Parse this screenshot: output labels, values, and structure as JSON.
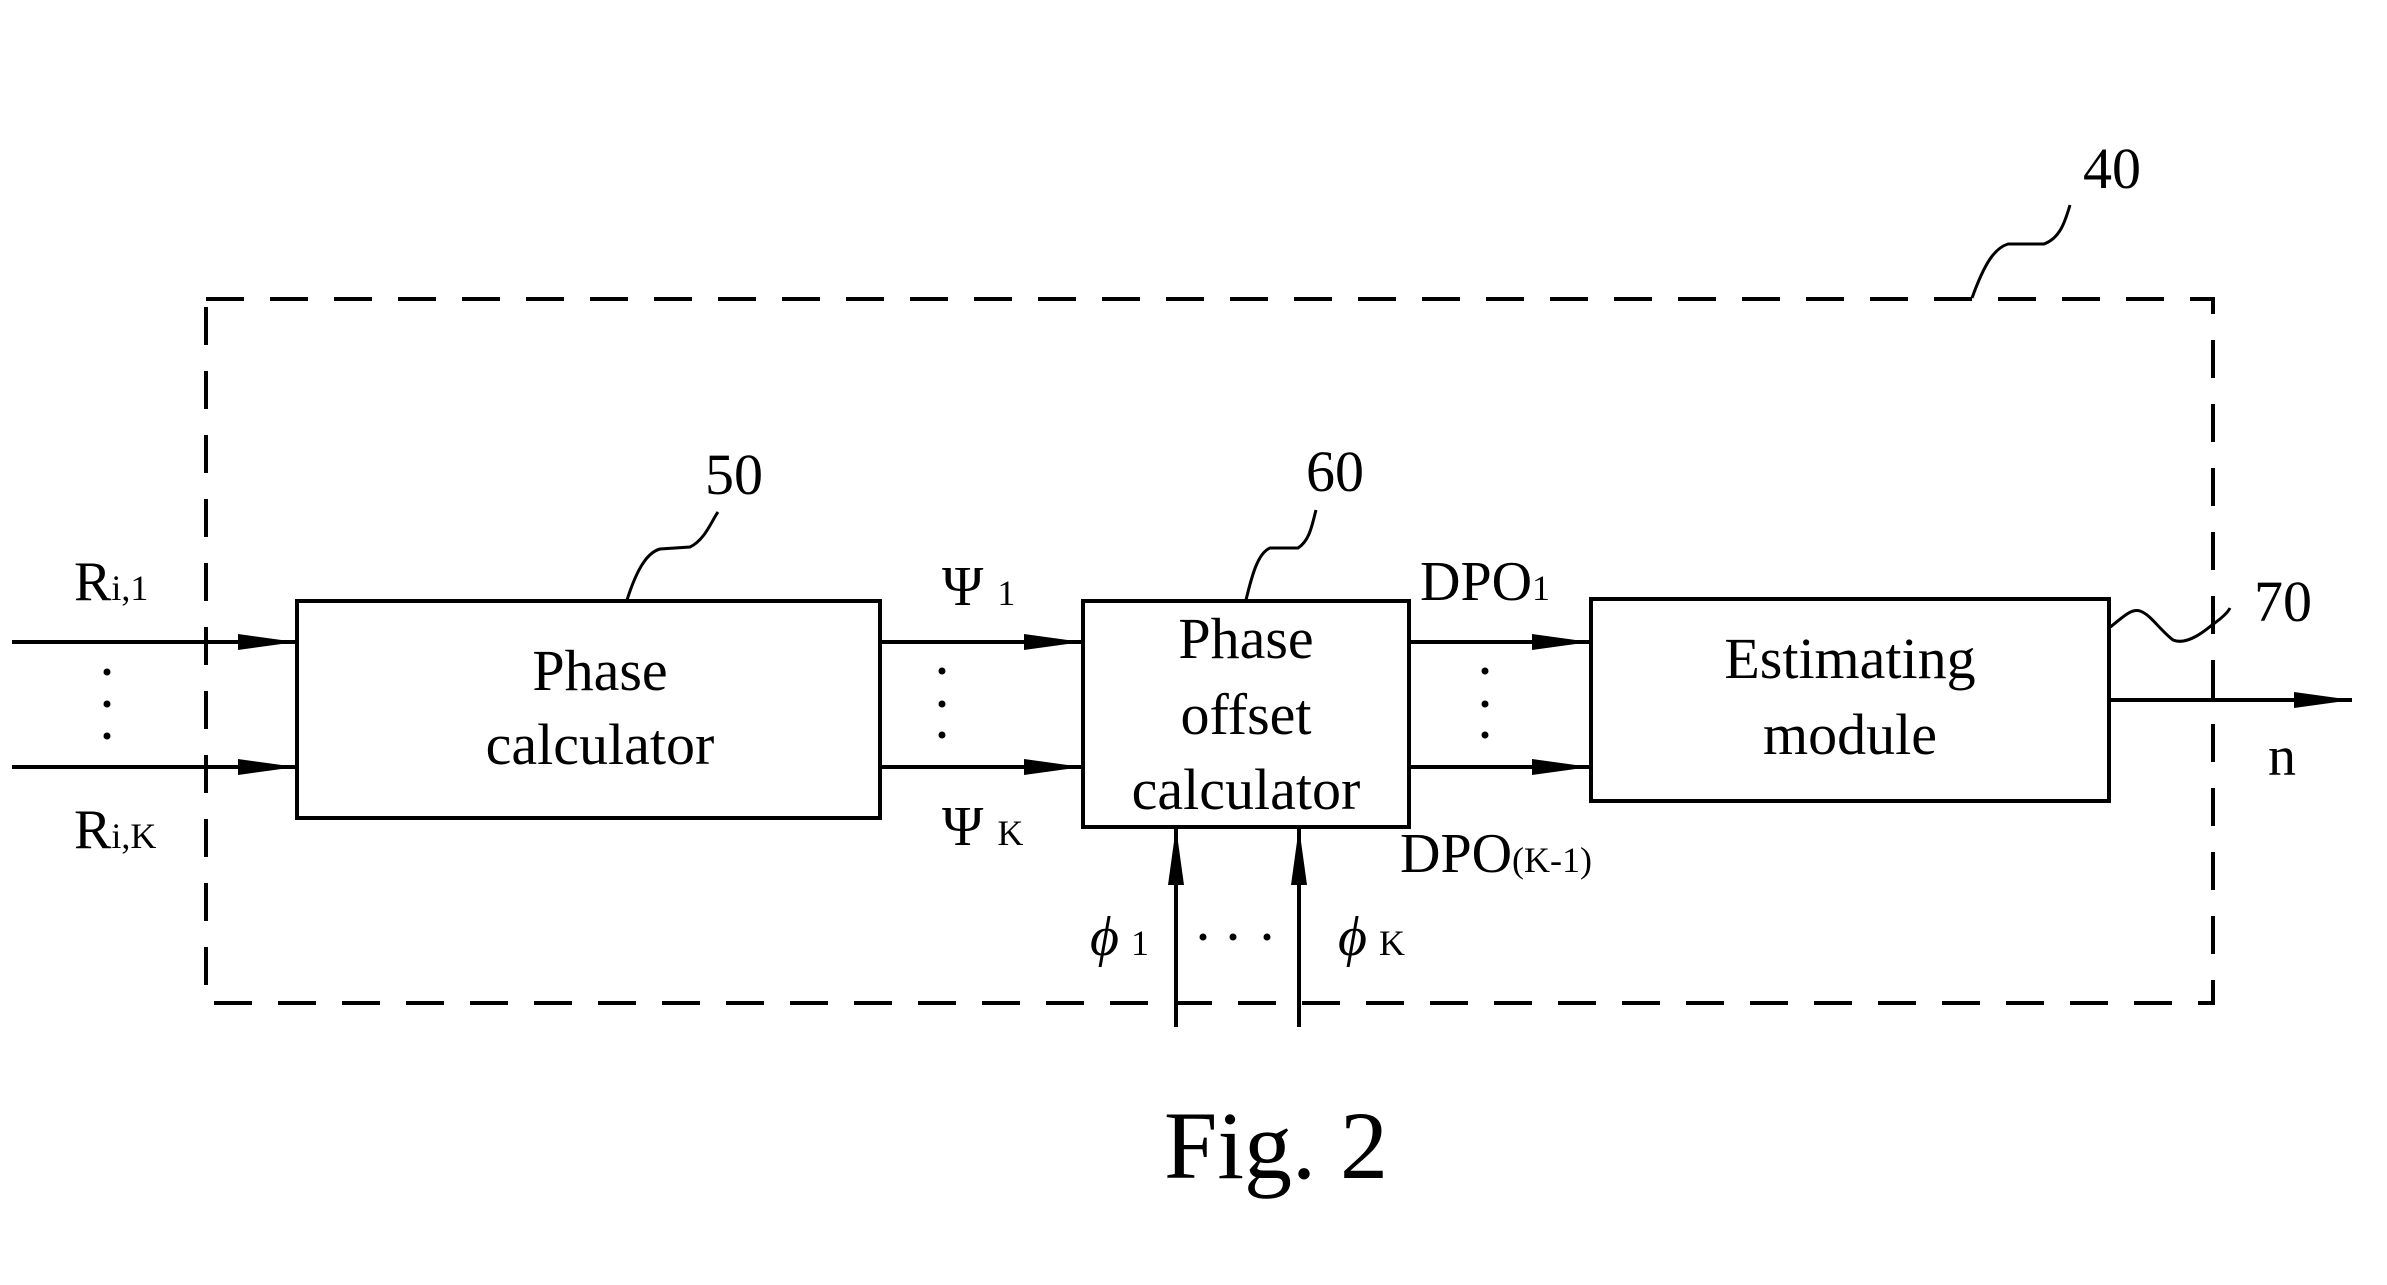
{
  "figure": {
    "caption": "Fig. 2",
    "system_ref": "40"
  },
  "blocks": [
    {
      "id": "phase-calculator",
      "ref": "50",
      "lines": [
        "Phase",
        "calculator"
      ]
    },
    {
      "id": "phase-offset-calculator",
      "ref": "60",
      "lines": [
        "Phase",
        "offset",
        "calculator"
      ]
    },
    {
      "id": "estimating-module",
      "ref": "70",
      "lines": [
        "Estimating",
        "module"
      ]
    }
  ],
  "signals": {
    "inputs": {
      "first": {
        "base": "R",
        "sub": "i,1"
      },
      "last": {
        "base": "R",
        "sub": "i,K"
      }
    },
    "phases": {
      "first": {
        "base": "Ψ",
        "sub": "1"
      },
      "last": {
        "base": "Ψ",
        "sub": "K"
      }
    },
    "offsets": {
      "first": {
        "base": "DPO",
        "sub": "1"
      },
      "last": {
        "base": "DPO",
        "sub": "(K-1)"
      }
    },
    "references": {
      "first": {
        "base": "ϕ",
        "sub": "1"
      },
      "last": {
        "base": "ϕ",
        "sub": "K"
      }
    },
    "output": {
      "label": "n"
    }
  }
}
